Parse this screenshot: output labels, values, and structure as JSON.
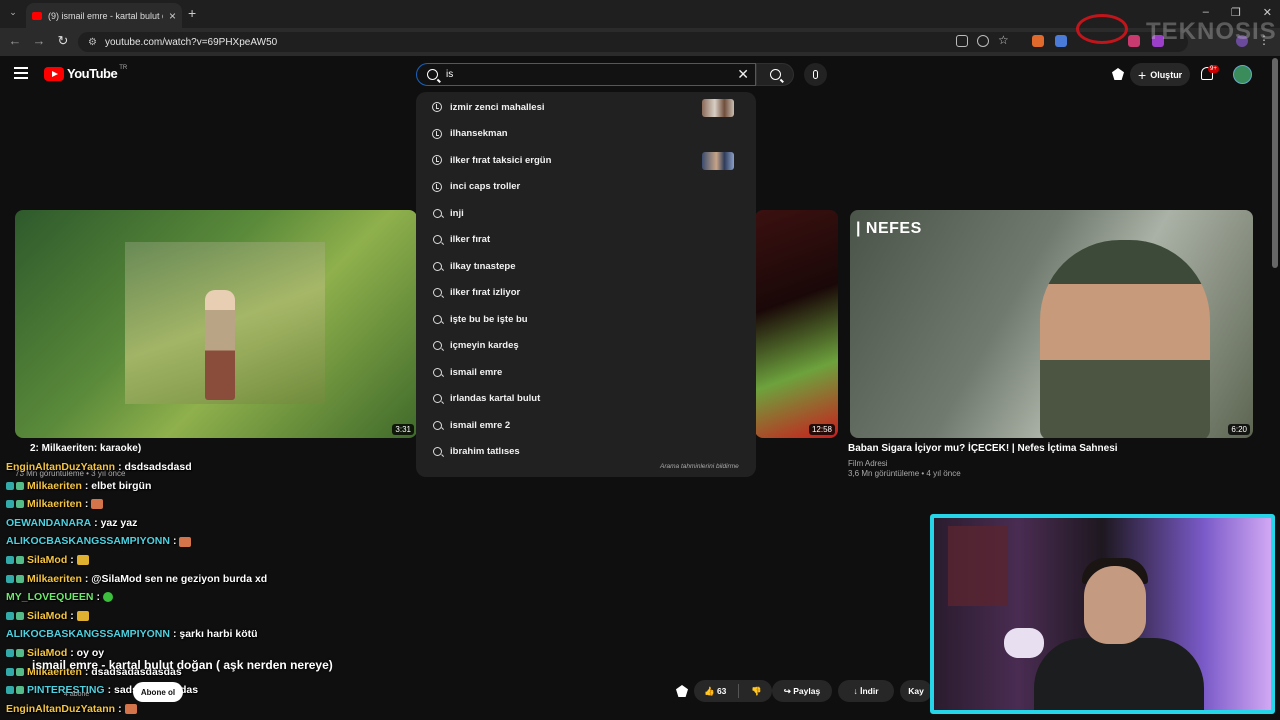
{
  "browser": {
    "tab_title": "(9) ismail emre - kartal bulut do",
    "url": "youtube.com/watch?v=69PHXpeAW50",
    "window_controls": [
      "–",
      "❐",
      "✕"
    ]
  },
  "overlay_logo": "TEKNOSIS",
  "header": {
    "logo_text": "YouTube",
    "logo_country": "TR",
    "search_value": "is",
    "create_label": "Oluştur",
    "notification_count": "9+"
  },
  "suggestions": [
    {
      "text": "izmir zenci mahallesi",
      "icon": "history-icon",
      "thumb": "a"
    },
    {
      "text": "ilhansekman",
      "icon": "history-icon"
    },
    {
      "text": "ilker fırat taksici ergün",
      "icon": "history-icon",
      "thumb": "b"
    },
    {
      "text": "inci caps troller",
      "icon": "history-icon"
    },
    {
      "text": "inji",
      "icon": "search-icon"
    },
    {
      "text": "ilker fırat",
      "icon": "search-icon"
    },
    {
      "text": "ilkay tınastepe",
      "icon": "search-icon"
    },
    {
      "text": "ilker fırat izliyor",
      "icon": "search-icon"
    },
    {
      "text": "işte bu be işte bu",
      "icon": "search-icon"
    },
    {
      "text": "içmeyin kardeş",
      "icon": "search-icon"
    },
    {
      "text": "ismail emre",
      "icon": "search-icon"
    },
    {
      "text": "irlandas kartal bulut",
      "icon": "search-icon"
    },
    {
      "text": "ismail emre 2",
      "icon": "search-icon"
    },
    {
      "text": "ibrahim tatlıses",
      "icon": "search-icon"
    }
  ],
  "prediction_report": "Arama tahminlerini bildirme",
  "videos": {
    "v1": {
      "duration": "3:31",
      "title": "2: Milkaeriten: karaoke)",
      "meta": "73 Mn görüntüleme • 3 yıl önce"
    },
    "v2": {
      "duration": "12:58"
    },
    "v3": {
      "duration": "6:20",
      "overlay_text": "| NEFES",
      "title": "Baban Sigara İçiyor mu? İÇECEK! | Nefes İçtima Sahnesi",
      "channel": "Film Adresi",
      "meta": "3,6 Mn görüntüleme • 4 yıl önce"
    }
  },
  "chat": [
    {
      "user": "EnginAltanDuzYatann",
      "color": "#f5c542",
      "msg": ": dsdsadsdasd",
      "badge": false
    },
    {
      "user": "Milkaeriten",
      "color": "#f5c542",
      "msg": ": elbet birgün",
      "badge": true
    },
    {
      "user": "Milkaeriten",
      "color": "#f5c542",
      "msg": ":",
      "badge": true,
      "emote": "emo"
    },
    {
      "user": "OEWANDANARA",
      "color": "#4fd1e0",
      "msg": ": yaz yaz",
      "badge": false
    },
    {
      "user": "ALIKOCBASKANGSSAMPIYONN",
      "color": "#4fd1e0",
      "msg": ":",
      "badge": false,
      "emote": "emo"
    },
    {
      "user": "SilaMod",
      "color": "#f5c542",
      "msg": ":",
      "badge": true,
      "emote": "g"
    },
    {
      "user": "Milkaeriten",
      "color": "#f5c542",
      "msg": ": @SilaMod sen ne geziyon burda xd",
      "badge": true
    },
    {
      "user": "MY_LOVEQUEEN",
      "color": "#6ee86e",
      "msg": ":",
      "badge": false,
      "emote": "gr"
    },
    {
      "user": "SilaMod",
      "color": "#f5c542",
      "msg": ":",
      "badge": true,
      "emote": "g"
    },
    {
      "user": "ALIKOCBASKANGSSAMPIYONN",
      "color": "#4fd1e0",
      "msg": ": şarkı harbi kötü",
      "badge": false
    },
    {
      "user": "SilaMod",
      "color": "#f5c542",
      "msg": ": oy oy",
      "badge": true
    },
    {
      "user": "Milkaeriten",
      "color": "#f5c542",
      "msg": ": dsadsadasdasdas",
      "badge": true
    },
    {
      "user": "PINTERESTING",
      "color": "#4fd1e0",
      "msg": ": sadsadsadasdas",
      "badge": true
    },
    {
      "user": "EnginAltanDuzYatann",
      "color": "#f5c542",
      "msg": ":",
      "badge": false,
      "emote": "emo"
    }
  ],
  "player": {
    "title": "ismail emre - kartal bulut doğan ( aşk nerden nereye)",
    "subscribers": "4 abone",
    "subscribe_label": "Abone ol",
    "likes": "63",
    "share_label": "Paylaş",
    "download_label": "İndir",
    "save_label": "Kay"
  }
}
